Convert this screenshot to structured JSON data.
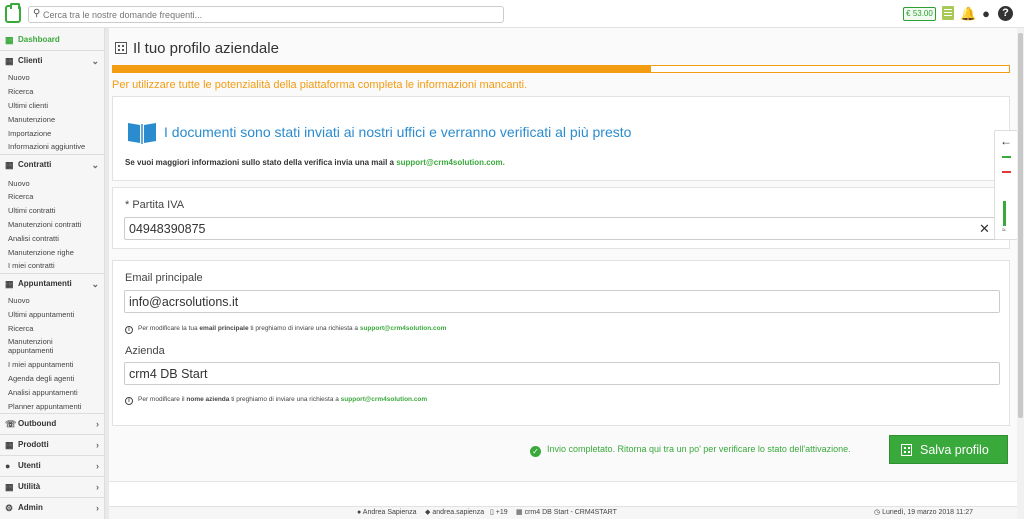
{
  "topbar": {
    "search_placeholder": "Cerca tra le nostre domande frequenti...",
    "credit": "€ 53.00"
  },
  "sidebar": {
    "dashboard": "Dashboard",
    "clienti": {
      "label": "Clienti",
      "items": [
        "Nuovo",
        "Ricerca",
        "Ultimi clienti",
        "Manutenzione",
        "Importazione",
        "Informazioni aggiuntive"
      ]
    },
    "contratti": {
      "label": "Contratti",
      "items": [
        "Nuovo",
        "Ricerca",
        "Ultimi contratti",
        "Manutenzioni contratti",
        "Analisi contratti",
        "Manutenzione righe",
        "I miei contratti"
      ]
    },
    "appuntamenti": {
      "label": "Appuntamenti",
      "items": [
        "Nuovo",
        "Ultimi appuntamenti",
        "Ricerca",
        "Manutenzioni appuntamenti",
        "I miei appuntamenti",
        "Agenda degli agenti",
        "Analisi appuntamenti",
        "Planner appuntamenti"
      ]
    },
    "outbound": "Outbound",
    "prodotti": "Prodotti",
    "utenti": "Utenti",
    "utilita": "Utilità",
    "admin": "Admin"
  },
  "main": {
    "title": "Il tuo profilo aziendale",
    "progress_percent": 60,
    "warning": "Per utilizzare tutte le potenzialità della piattaforma completa le informazioni mancanti.",
    "headline": "I documenti sono stati inviati ai nostri uffici e verranno verificati al più presto",
    "subline_text": "Se vuoi maggiori informazioni sullo stato della verifica invia una mail a ",
    "subline_link": "support@crm4solution.com.",
    "piva_label": "* Partita IVA",
    "piva_value": "04948390875",
    "email_label": "Email principale",
    "email_value": "info@acrsolutions.it",
    "email_note_pre": "Per modificare la tua ",
    "email_note_bold": "email principale",
    "email_note_post": " ti preghiamo di inviare una richiesta a ",
    "azienda_label": "Azienda",
    "azienda_value": "crm4 DB Start",
    "azienda_note_pre": "Per modificare il ",
    "azienda_note_bold": "nome azienda",
    "azienda_note_post": " ti preghiamo di inviare una richiesta a ",
    "support_email": "support@crm4solution.com",
    "success": "Invio completato. Ritorna qui tra un po' per verificare lo stato dell'attivazione.",
    "save_label": "Salva profilo"
  },
  "statusbar": {
    "user": "Andrea Sapienza",
    "username": "andrea.sapienza",
    "phone": "+19",
    "db": "crm4 DB Start - CRM4START",
    "datetime": "Lunedì, 19 marzo 2018 11:27"
  },
  "colors": {
    "brand_green": "#3aa93c",
    "warning_orange": "#f39c12",
    "headline_blue": "#2a8ccf"
  }
}
